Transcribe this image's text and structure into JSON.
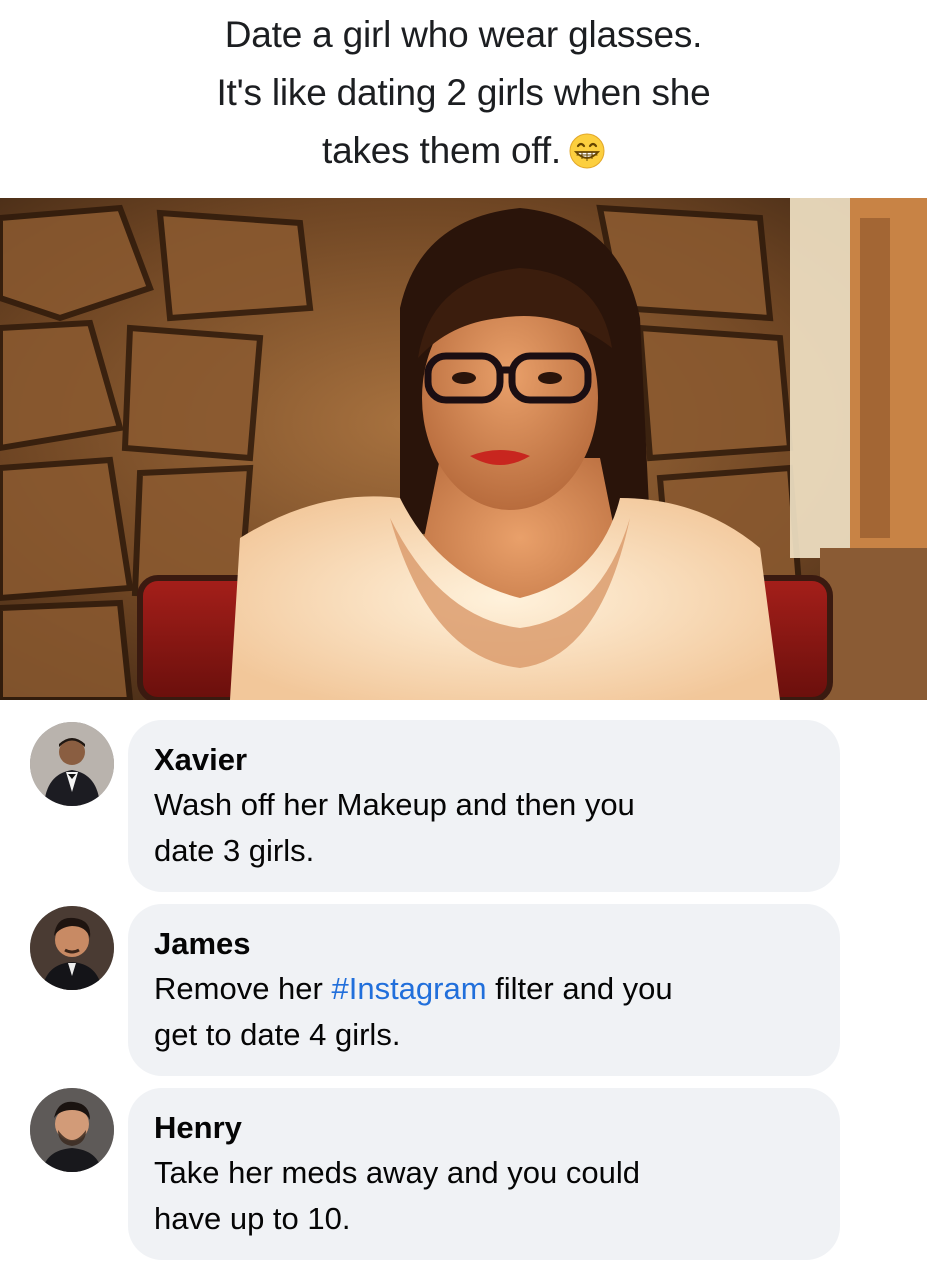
{
  "post": {
    "caption_lines": [
      "Date a girl who wear glasses.",
      "It's like dating 2 girls when she",
      "takes them off."
    ],
    "caption_emoji": "grinning-face-with-smiling-eyes-emoji"
  },
  "photo": {
    "subject": "woman-with-glasses-photo"
  },
  "comments": [
    {
      "author": "Xavier",
      "text_lines": [
        "Wash off her Makeup and then you",
        "date 3 girls."
      ],
      "avatar_icon": "man-in-tuxedo-avatar"
    },
    {
      "author": "James",
      "text_before": "Remove her ",
      "hashtag": "#Instagram",
      "text_after": " filter and you",
      "text_line2": "get to date 4 girls.",
      "avatar_icon": "dark-haired-man-avatar"
    },
    {
      "author": "Henry",
      "text_lines": [
        "Take her meds away and you could",
        "have up to 10."
      ],
      "avatar_icon": "bearded-man-avatar"
    }
  ],
  "colors": {
    "bubble_background": "#f0f2f5",
    "hashtag_link": "#216fdb",
    "text": "#050505"
  }
}
